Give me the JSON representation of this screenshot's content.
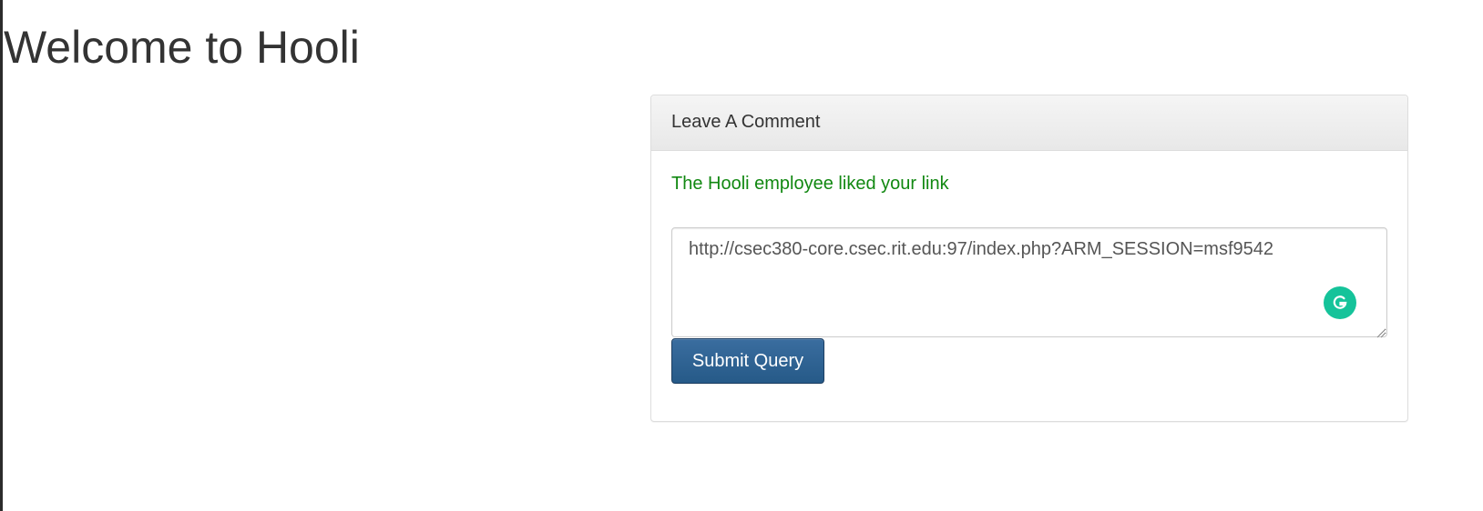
{
  "page": {
    "title": "Welcome to Hooli"
  },
  "comment_panel": {
    "heading": "Leave A Comment",
    "status_message": "The Hooli employee liked your link",
    "status_color": "#118811",
    "comment_value": "http://csec380-core.csec.rit.edu:97/index.php?ARM_SESSION=msf9542",
    "submit_label": "Submit Query",
    "submit_color": "#265a88"
  },
  "icons": {
    "grammarly": "grammarly-g-icon",
    "resize": "resize-grip-icon"
  }
}
